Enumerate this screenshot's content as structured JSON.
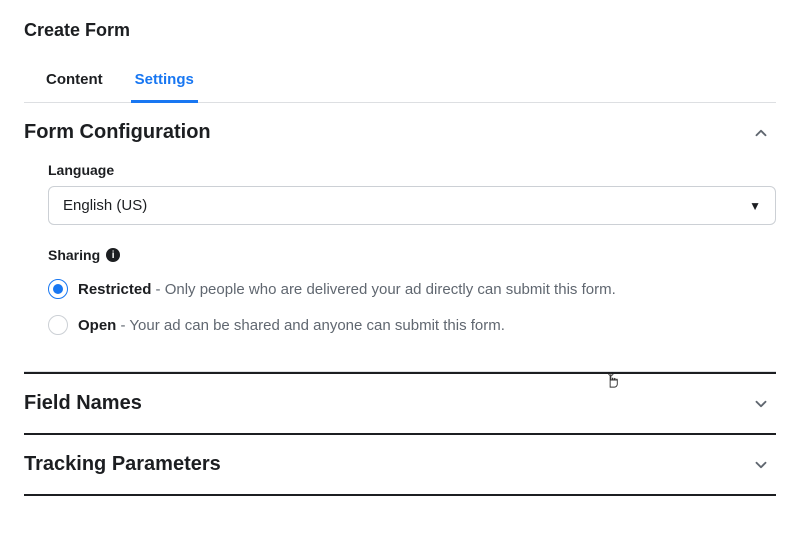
{
  "page": {
    "title": "Create Form"
  },
  "tabs": {
    "content": "Content",
    "settings": "Settings"
  },
  "sections": {
    "formConfig": {
      "title": "Form Configuration",
      "language": {
        "label": "Language",
        "value": "English (US)"
      },
      "sharing": {
        "label": "Sharing",
        "options": {
          "restricted": {
            "name": "Restricted",
            "desc": " - Only people who are delivered your ad directly can submit this form."
          },
          "open": {
            "name": "Open",
            "desc": " - Your ad can be shared and anyone can submit this form."
          }
        }
      }
    },
    "fieldNames": {
      "title": "Field Names"
    },
    "trackingParams": {
      "title": "Tracking Parameters"
    }
  }
}
